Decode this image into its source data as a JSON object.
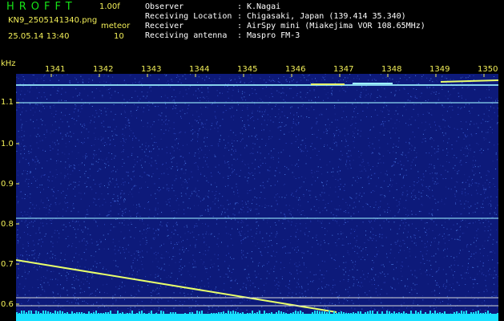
{
  "header": {
    "app_title": "HROFFT",
    "version": "1.00f",
    "filename": "KN9_2505141340.png",
    "meteor_label": "meteor",
    "datetime": "25.05.14 13:40",
    "meteor_count": "10",
    "info": [
      {
        "key": "Observer",
        "colon": ":",
        "value": "K.Nagai"
      },
      {
        "key": "Receiving Location",
        "colon": ":",
        "value": "Chigasaki, Japan (139.414 35.340)"
      },
      {
        "key": "Receiver",
        "colon": ":",
        "value": "AirSpy mini (Miakejima VOR 108.65MHz)"
      },
      {
        "key": "Receiving antenna",
        "colon": ":",
        "value": "Maspro FM-3"
      }
    ]
  },
  "chart_data": {
    "type": "heatmap",
    "ylabel": "kHz",
    "x_ticks": [
      "1341",
      "1342",
      "1343",
      "1344",
      "1345",
      "1346",
      "1347",
      "1348",
      "1349",
      "1350"
    ],
    "y_ticks": [
      "1.1",
      "1.0",
      "0.9",
      "0.8",
      "0.7",
      "0.6"
    ],
    "colors": {
      "background": "#0d1a7a",
      "signal": "#9cf0ff",
      "trace": "#e8ff6a",
      "noise_floor": "#19e0ff"
    }
  }
}
